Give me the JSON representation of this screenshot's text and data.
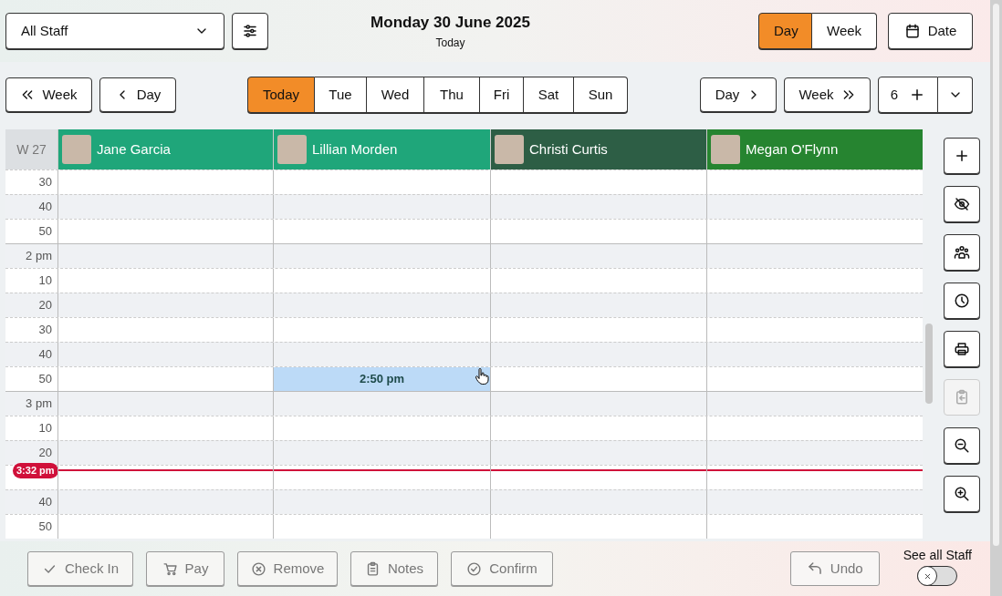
{
  "staff_filter": {
    "value": "All Staff"
  },
  "header": {
    "date": "Monday 30 June 2025",
    "subtitle": "Today"
  },
  "view_toggle": [
    {
      "label": "Day",
      "selected": true
    },
    {
      "label": "Week",
      "selected": false
    }
  ],
  "date_button": "Date",
  "nav_back": [
    {
      "label": "Week",
      "kind": "double"
    },
    {
      "label": "Day",
      "kind": "single"
    }
  ],
  "days": [
    {
      "label": "Today",
      "selected": true
    },
    {
      "label": "Tue",
      "selected": false
    },
    {
      "label": "Wed",
      "selected": false
    },
    {
      "label": "Thu",
      "selected": false
    },
    {
      "label": "Fri",
      "selected": false
    },
    {
      "label": "Sat",
      "selected": false
    },
    {
      "label": "Sun",
      "selected": false
    }
  ],
  "nav_forward": [
    {
      "label": "Day",
      "kind": "single"
    },
    {
      "label": "Week",
      "kind": "double"
    }
  ],
  "column_count": "6",
  "week_label": "W 27",
  "staff": [
    {
      "name": "Jane Garcia",
      "color": "#1fa67a"
    },
    {
      "name": "Lillian Morden",
      "color": "#1fa67a"
    },
    {
      "name": "Christi Curtis",
      "color": "#2d5e45"
    },
    {
      "name": "Megan O'Flynn",
      "color": "#268430"
    }
  ],
  "rows": [
    {
      "label": "30",
      "hour": false
    },
    {
      "label": "40",
      "hour": false
    },
    {
      "label": "50",
      "hour": false
    },
    {
      "label": "2 pm",
      "hour": true
    },
    {
      "label": "10",
      "hour": false
    },
    {
      "label": "20",
      "hour": false
    },
    {
      "label": "30",
      "hour": false
    },
    {
      "label": "40",
      "hour": false
    },
    {
      "label": "50",
      "hour": false,
      "slots": [
        {
          "selected": false
        },
        {
          "selected": true,
          "label": "2:50 pm"
        },
        {
          "selected": false
        },
        {
          "selected": false
        }
      ]
    },
    {
      "label": "3 pm",
      "hour": true
    },
    {
      "label": "10",
      "hour": false
    },
    {
      "label": "20",
      "hour": false
    },
    {
      "hour": false,
      "now_label": "3:32 pm"
    },
    {
      "label": "40",
      "hour": false
    },
    {
      "label": "50",
      "hour": false
    }
  ],
  "tools": [
    {
      "kind": "add",
      "disabled": false
    },
    {
      "kind": "hide",
      "disabled": false
    },
    {
      "kind": "group",
      "disabled": false
    },
    {
      "kind": "clock",
      "disabled": false
    },
    {
      "kind": "print",
      "disabled": false
    },
    {
      "kind": "paste",
      "disabled": true
    },
    {
      "kind": "zoom-out",
      "disabled": false
    },
    {
      "kind": "zoom-in",
      "disabled": false
    }
  ],
  "actions": [
    {
      "label": "Check In",
      "kind": "check",
      "disabled": true
    },
    {
      "label": "Pay",
      "kind": "cart",
      "disabled": true
    },
    {
      "label": "Remove",
      "kind": "remove",
      "disabled": true
    },
    {
      "label": "Notes",
      "kind": "notes",
      "disabled": true
    },
    {
      "label": "Confirm",
      "kind": "confirm",
      "disabled": true
    }
  ],
  "undo": {
    "label": "Undo",
    "disabled": true
  },
  "see_all_staff": {
    "label": "See all Staff",
    "on": false
  }
}
